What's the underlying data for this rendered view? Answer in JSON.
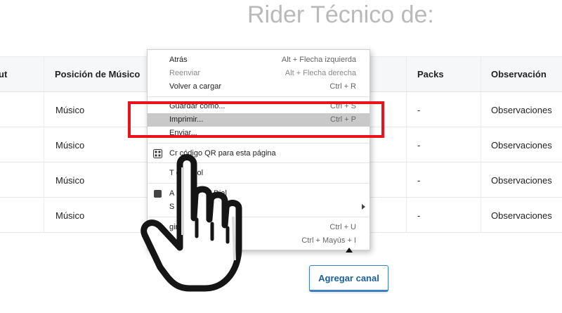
{
  "page": {
    "title": "Rider Técnico de:"
  },
  "table": {
    "headers": [
      "ut",
      "Posición de Músico",
      "Packs",
      "Observación"
    ],
    "rows": [
      {
        "position": "Músico",
        "packs": "-",
        "observation": "Observaciones"
      },
      {
        "position": "Músico",
        "packs": "-",
        "observation": "Observaciones"
      },
      {
        "position": "Músico",
        "packs": "-",
        "observation": "Observaciones"
      },
      {
        "position": "Músico",
        "packs": "-",
        "observation": "Observaciones"
      }
    ]
  },
  "add_button": {
    "label": "Agregar canal"
  },
  "context_menu": {
    "items": [
      {
        "label": "Atrás",
        "shortcut": "Alt + Flecha izquierda",
        "disabled": false
      },
      {
        "label": "Reenviar",
        "shortcut": "Alt + Flecha derecha",
        "disabled": true
      },
      {
        "label": "Volver a cargar",
        "shortcut": "Ctrl + R",
        "disabled": false
      },
      {
        "label": "Guardar como...",
        "shortcut": "Ctrl + S",
        "disabled": false
      },
      {
        "label": "Imprimir...",
        "shortcut": "Ctrl + P",
        "disabled": false,
        "highlighted": true
      },
      {
        "label": "Enviar...",
        "shortcut": "",
        "disabled": false
      },
      {
        "label": "Cr    código QR para esta página",
        "shortcut": "",
        "icon": "qr-code-icon"
      },
      {
        "label": "T      español",
        "shortcut": ""
      },
      {
        "label": "A                  me Speed Dial",
        "shortcut": "",
        "icon": "extension-icon"
      },
      {
        "label": "S",
        "shortcut": "",
        "submenu": true
      },
      {
        "label": "                   gina",
        "shortcut": "Ctrl + U"
      },
      {
        "label": "",
        "shortcut": "Ctrl + Mayús + I"
      }
    ]
  },
  "colors": {
    "highlight_box": "#e8141b",
    "button_accent": "#3b82c4",
    "menu_hover": "#c9c9c9"
  },
  "cursor": {
    "icon": "pointing-hand-cursor-icon"
  }
}
